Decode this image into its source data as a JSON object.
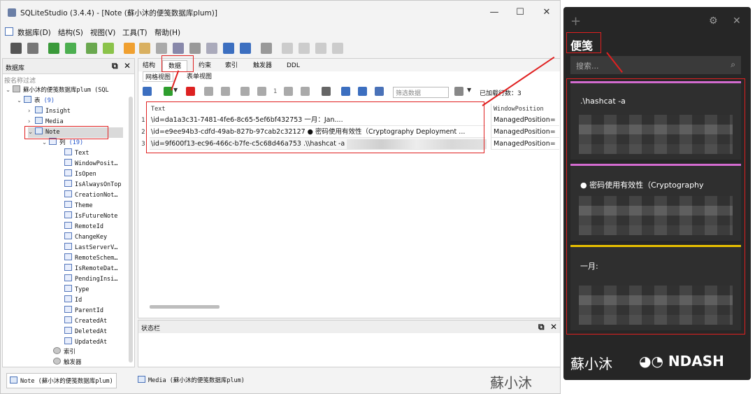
{
  "window": {
    "title": "SQLiteStudio (3.4.4) - [Note (蘇小沐的便笺数据库plum)]",
    "minimize": "—",
    "maximize": "☐",
    "close": "✕"
  },
  "menu": [
    "数据库(D)",
    "结构(S)",
    "视图(V)",
    "工具(T)",
    "帮助(H)"
  ],
  "left_panel": {
    "title": "数据库",
    "filter_placeholder": "按名称过滤",
    "tree": {
      "database": "蘇小沐的便笺数据库plum (SQL",
      "tables_label": "表",
      "tables_count": "(9)",
      "tables": [
        "Insight",
        "Media",
        "Note"
      ],
      "columns_label": "列",
      "columns_count": "(19)",
      "columns": [
        "Text",
        "WindowPosit…",
        "IsOpen",
        "IsAlwaysOnTop",
        "CreationNot…",
        "Theme",
        "IsFutureNote",
        "RemoteId",
        "ChangeKey",
        "LastServerV…",
        "RemoteSchem…",
        "IsRemoteDat…",
        "PendingInsi…",
        "Type",
        "Id",
        "ParentId",
        "CreatedAt",
        "DeletedAt",
        "UpdatedAt"
      ],
      "indexes": "索引",
      "triggers": "触发器"
    }
  },
  "main": {
    "tabs": [
      "结构",
      "数据",
      "约束",
      "索引",
      "触发器",
      "DDL"
    ],
    "subtabs": [
      "网格视图",
      "表单视图"
    ],
    "filter_placeholder": "筛选数据",
    "row_count": "已加载行数：3",
    "page": "1",
    "columns": [
      "Text",
      "WindowPosition"
    ],
    "rows": [
      {
        "num": "1",
        "text": "\\id=da1a3c31-7481-4fe6-8c65-5ef6bf432753 一月：Jan....",
        "win": "ManagedPosition="
      },
      {
        "num": "2",
        "text": "\\id=e9ee94b3-cdfd-49ab-827b-97cab2c32127 ● 密码使用有效性（Cryptography Deployment ...",
        "win": "ManagedPosition="
      },
      {
        "num": "3",
        "text": "\\id=9f600f13-ec96-466c-b7fe-c5c68d46a753 .\\\\hashcat -a",
        "win": "ManagedPosition="
      }
    ]
  },
  "statusbar": {
    "title": "状态栏"
  },
  "bottom_tabs": [
    "Note (蘇小沐的便笺数据库plum)",
    "Media (蘇小沐的便笺数据库plum)"
  ],
  "watermark": "蘇小沐",
  "notes_app": {
    "plus": "+",
    "title": "便笺",
    "search_placeholder": "搜索...",
    "cards": [
      {
        "text": ".\\hashcat -a",
        "color": "#d36bd0"
      },
      {
        "text": "● 密码使用有效性（Cryptography",
        "color": "#d36bd0"
      },
      {
        "text": "一月:",
        "color": "#e8c000"
      }
    ],
    "brand": "蘇小沐",
    "logo": "NDASH"
  },
  "colors": {
    "highlight": "#e02020",
    "accent": "#4a72b8"
  }
}
